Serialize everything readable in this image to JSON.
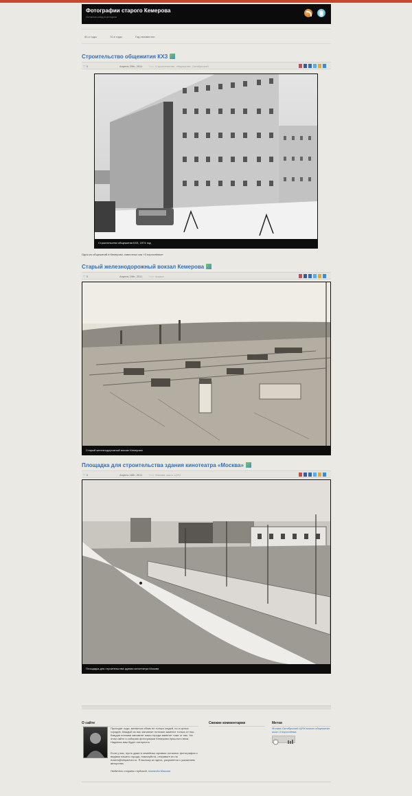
{
  "site": {
    "title": "Фотографии старого Кемерова",
    "description": "Остался след в истории"
  },
  "nav": {
    "items": [
      "50-е годы",
      "70-е годы",
      "Год неизвестен"
    ]
  },
  "posts": [
    {
      "title": "Строительство общежития КХЗ",
      "comments": "0",
      "date": "Апрель 20th, 2011",
      "tags_label": "Тэги:",
      "tags": "Строительство, общежитие, Октябрьский",
      "caption": "Строительство общежития КХЗ, 1974 год",
      "text": "Одно из общежитий в Кемерово, известных как «3 порослёвка»"
    },
    {
      "title": "Старый железнодорожный вокзал Кемерова",
      "comments": "0",
      "date": "Апрель 19th, 2011",
      "tags_label": "Тэги:",
      "tags": "вокзал",
      "caption": "Старый железнодорожный вокзал Кемерова"
    },
    {
      "title": "Площадка для строительства здания кинотеатра «Москва»",
      "comments": "0",
      "date": "Апрель 18th, 2011",
      "tags_label": "Тэги:",
      "tags": "Москва, школ, ЦУМ",
      "caption": "Площадка для строительства здания кинотеатра Москва"
    }
  ],
  "footer": {
    "about_heading": "О сайте",
    "comments_heading": "Свежие комментарии",
    "tags_heading": "Метки",
    "about_p1": "Проходят годы, меняется облик не только людей, но и целых городов. Каждый из нас запомнит потомки заменит только от нас. Каждая потомки запомнят наши города заменит тоже от нас. На этом сайте я собираю фотографии Кемерова прошлого века. Надеюсь вам будет интересно.",
    "about_p2": "Если у вас, пусть даже в семейных архивах остались фотографии с видами нашего города, пожалуйста, отправьте их на maxim@shipachev.ru. Я выложу их здесь, разумеется с указанием авторства.",
    "about_sign": "Любитель старины глубокой,",
    "about_author": "Шипачёв Максим",
    "tags_cloud": "Москва Октябрьский ЦУМ вокзал общежитие школ 3 порослёвка"
  },
  "colors": {
    "accent": "#2f6fb7",
    "topbar": "#c8462a",
    "header": "#0b0b0b",
    "background": "#ebe9e4"
  },
  "icons": [
    "rss-icon",
    "twitter-bird-icon",
    "heart-icon",
    "tag-icon",
    "share-icons"
  ]
}
